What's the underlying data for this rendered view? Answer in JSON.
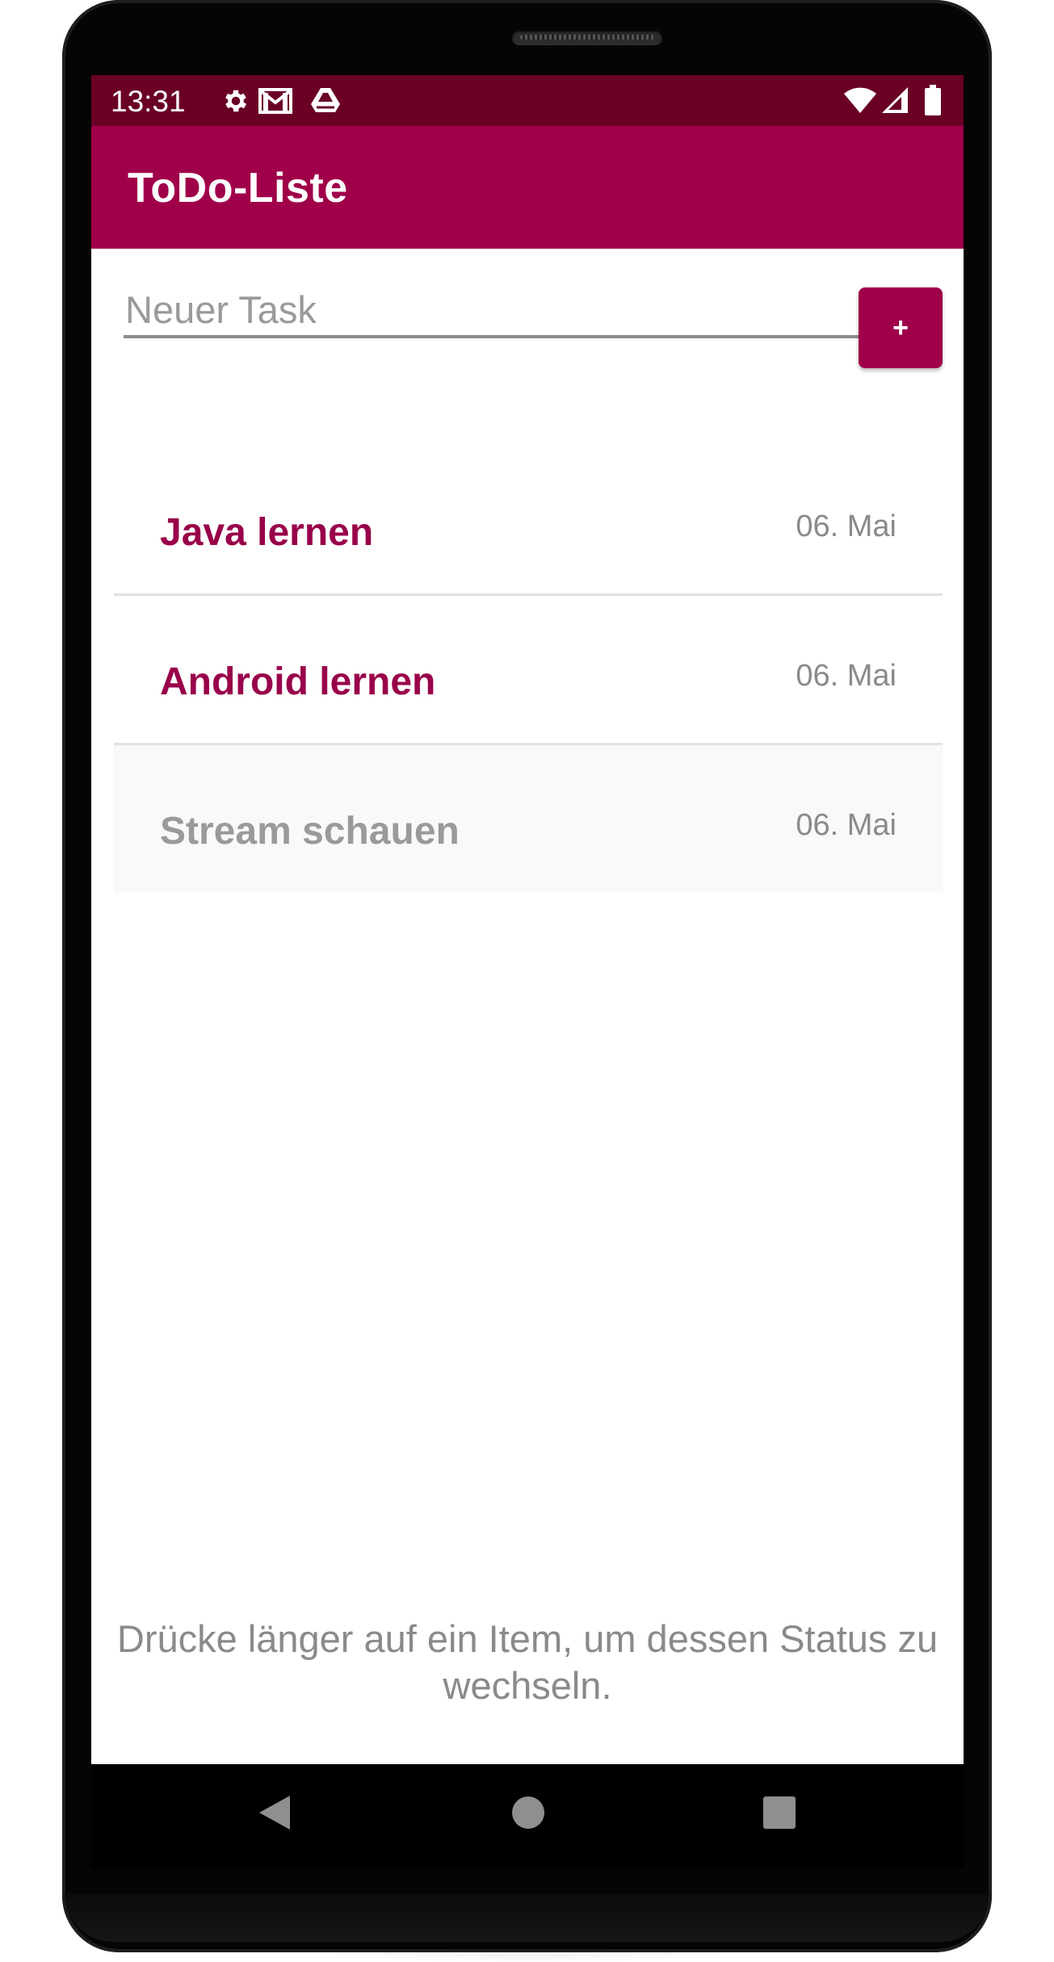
{
  "status_bar": {
    "time": "13:31",
    "icons_left": [
      "gear-icon",
      "gmail-icon",
      "drive-icon"
    ],
    "icons_right": [
      "wifi-icon",
      "signal-icon",
      "battery-icon"
    ]
  },
  "app_bar": {
    "title": "ToDo-Liste"
  },
  "input": {
    "placeholder": "Neuer Task",
    "value": ""
  },
  "add_button": {
    "label": "+"
  },
  "tasks": [
    {
      "title": "Java lernen",
      "date": "06. Mai",
      "done": false
    },
    {
      "title": "Android lernen",
      "date": "06. Mai",
      "done": false
    },
    {
      "title": "Stream schauen",
      "date": "06. Mai",
      "done": true
    }
  ],
  "hint": "Drücke länger auf ein Item, um dessen Status zu wechseln.",
  "nav_bar": {
    "buttons": [
      "back-icon",
      "home-icon",
      "recents-icon"
    ]
  },
  "colors": {
    "status_bar": "#6a0026",
    "primary": "#a0004a",
    "task_title": "#99004a",
    "done_text": "#9a9a9a",
    "secondary_text": "#8a8a8a"
  }
}
